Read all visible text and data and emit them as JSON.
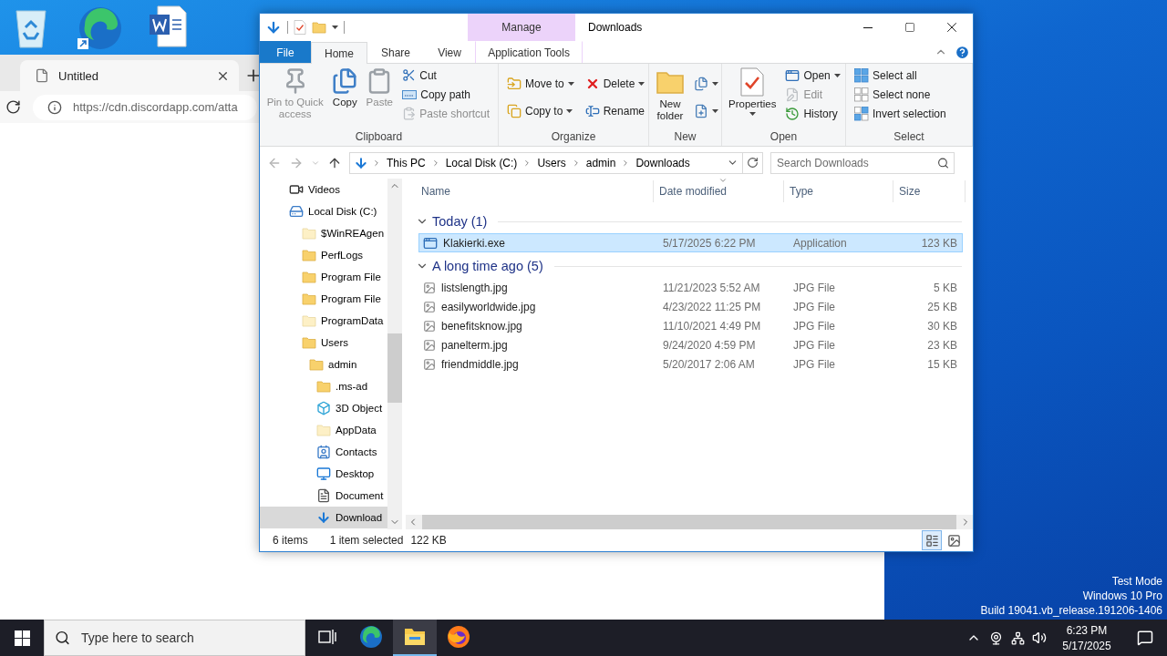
{
  "desktop": {
    "icons": [
      {
        "kind": "recycle-bin"
      },
      {
        "kind": "edge"
      },
      {
        "kind": "word"
      }
    ],
    "watermark": [
      "Test Mode",
      "Windows 10 Pro",
      "Build 19041.vb_release.191206-1406"
    ]
  },
  "browser": {
    "tab_title": "Untitled",
    "url": "https://cdn.discordapp.com/atta"
  },
  "explorer": {
    "title": "Downloads",
    "contextual_header": "Manage",
    "tabs": [
      {
        "label": "File",
        "kind": "file",
        "selected": false
      },
      {
        "label": "Home",
        "kind": "tab",
        "selected": true
      },
      {
        "label": "Share",
        "kind": "tab",
        "selected": false
      },
      {
        "label": "View",
        "kind": "tab",
        "selected": false
      },
      {
        "label": "Application Tools",
        "kind": "contextual",
        "selected": false
      }
    ],
    "ribbon": {
      "groups": [
        {
          "label": "Clipboard",
          "large": [
            {
              "label": "Pin to Quick access",
              "disabled": true,
              "dropdown": false
            },
            {
              "label": "Copy",
              "disabled": false,
              "dropdown": false
            },
            {
              "label": "Paste",
              "disabled": true,
              "dropdown": false
            }
          ],
          "columns": [
            [
              {
                "label": "Cut",
                "disabled": false,
                "dropdown": false
              },
              {
                "label": "Copy path",
                "disabled": false,
                "dropdown": false
              },
              {
                "label": "Paste shortcut",
                "disabled": true,
                "dropdown": false
              }
            ]
          ]
        },
        {
          "label": "Organize",
          "columns": [
            [
              {
                "label": "Move to",
                "disabled": false,
                "dropdown": true
              },
              {
                "label": "Copy to",
                "disabled": false,
                "dropdown": true
              }
            ],
            [
              {
                "label": "Delete",
                "disabled": false,
                "dropdown": true
              },
              {
                "label": "Rename",
                "disabled": false,
                "dropdown": false
              }
            ]
          ]
        },
        {
          "label": "New",
          "large": [
            {
              "label": "New folder",
              "disabled": false,
              "dropdown": false
            }
          ],
          "columns": [
            [
              {
                "disabled": false,
                "dropdown": true
              },
              {
                "disabled": false,
                "dropdown": true
              }
            ]
          ]
        },
        {
          "label": "Open",
          "large": [
            {
              "label": "Properties",
              "disabled": false,
              "dropdown": true
            }
          ],
          "columns": [
            [
              {
                "label": "Open",
                "disabled": false,
                "dropdown": true
              },
              {
                "label": "Edit",
                "disabled": true,
                "dropdown": false
              },
              {
                "label": "History",
                "disabled": false,
                "dropdown": false
              }
            ]
          ]
        },
        {
          "label": "Select",
          "columns": [
            [
              {
                "label": "Select all",
                "disabled": false,
                "dropdown": false
              },
              {
                "label": "Select none",
                "disabled": false,
                "dropdown": false
              },
              {
                "label": "Invert selection",
                "disabled": false,
                "dropdown": false
              }
            ]
          ]
        }
      ]
    },
    "address": {
      "path": [
        "This PC",
        "Local Disk (C:)",
        "Users",
        "admin",
        "Downloads"
      ],
      "search_placeholder": "Search Downloads"
    },
    "nav": {
      "items": [
        {
          "label": "Videos",
          "kind": "videos",
          "selected": false
        },
        {
          "label": "Local Disk (C:)",
          "kind": "drive",
          "selected": false,
          "children": [
            {
              "label": "$WinREAgen",
              "kind": "hidden-folder",
              "selected": false
            },
            {
              "label": "PerfLogs",
              "kind": "folder",
              "selected": false
            },
            {
              "label": "Program File",
              "kind": "folder",
              "selected": false
            },
            {
              "label": "Program File",
              "kind": "folder",
              "selected": false
            },
            {
              "label": "ProgramData",
              "kind": "hidden-folder",
              "selected": false
            },
            {
              "label": "Users",
              "kind": "folder",
              "selected": false,
              "children": [
                {
                  "label": "admin",
                  "kind": "folder",
                  "selected": false,
                  "children": [
                    {
                      "label": ".ms-ad",
                      "kind": "folder",
                      "selected": false
                    },
                    {
                      "label": "3D Object",
                      "kind": "objects",
                      "selected": false
                    },
                    {
                      "label": "AppData",
                      "kind": "hidden-folder",
                      "selected": false
                    },
                    {
                      "label": "Contacts",
                      "kind": "contacts",
                      "selected": false
                    },
                    {
                      "label": "Desktop",
                      "kind": "desktop",
                      "selected": false
                    },
                    {
                      "label": "Document",
                      "kind": "documents",
                      "selected": false
                    },
                    {
                      "label": "Download",
                      "kind": "downloads",
                      "selected": true
                    }
                  ]
                }
              ]
            }
          ]
        }
      ]
    },
    "columns": [
      {
        "label": "Name",
        "sorted": false
      },
      {
        "label": "Date modified",
        "sorted": true
      },
      {
        "label": "Type",
        "sorted": false
      },
      {
        "label": "Size",
        "sorted": false
      }
    ],
    "groups": [
      {
        "label": "Today (1)",
        "expanded": true,
        "files": [
          {
            "name": "Klakierki.exe",
            "kind": "application",
            "date": "5/17/2025 6:22 PM",
            "type": "Application",
            "size": "123 KB",
            "selected": true
          }
        ]
      },
      {
        "label": "A long time ago (5)",
        "expanded": true,
        "files": [
          {
            "name": "listslength.jpg",
            "kind": "image",
            "date": "11/21/2023 5:52 AM",
            "type": "JPG File",
            "size": "5 KB",
            "selected": false
          },
          {
            "name": "easilyworldwide.jpg",
            "kind": "image",
            "date": "4/23/2022 11:25 PM",
            "type": "JPG File",
            "size": "25 KB",
            "selected": false
          },
          {
            "name": "benefitsknow.jpg",
            "kind": "image",
            "date": "11/10/2021 4:49 PM",
            "type": "JPG File",
            "size": "30 KB",
            "selected": false
          },
          {
            "name": "panelterm.jpg",
            "kind": "image",
            "date": "9/24/2020 4:59 PM",
            "type": "JPG File",
            "size": "23 KB",
            "selected": false
          },
          {
            "name": "friendmiddle.jpg",
            "kind": "image",
            "date": "5/20/2017 2:06 AM",
            "type": "JPG File",
            "size": "15 KB",
            "selected": false
          }
        ]
      }
    ],
    "status": {
      "count": "6 items",
      "selection": "1 item selected",
      "size": "122 KB"
    },
    "views": [
      {
        "kind": "details",
        "selected": true
      },
      {
        "kind": "large-icons",
        "selected": false
      }
    ]
  },
  "taskbar": {
    "search_placeholder": "Type here to search",
    "apps": [
      {
        "kind": "task-view",
        "selected": false
      },
      {
        "kind": "edge",
        "selected": false
      },
      {
        "kind": "explorer",
        "selected": true
      },
      {
        "kind": "firefox",
        "selected": false
      }
    ],
    "clock": {
      "time": "6:23 PM",
      "date": "5/17/2025"
    }
  }
}
